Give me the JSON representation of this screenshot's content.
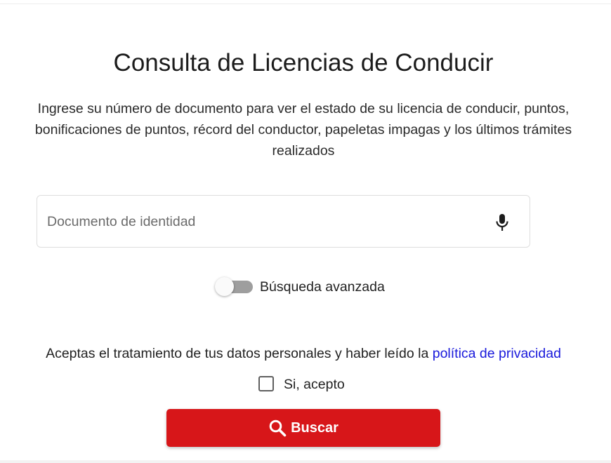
{
  "page": {
    "title": "Consulta de Licencias de Conducir",
    "description": "Ingrese su número de documento para ver el estado de su licencia de conducir, puntos, bonificaciones de puntos, récord del conductor, papeletas impagas y los últimos trámites realizados"
  },
  "search": {
    "placeholder": "Documento de identidad",
    "value": "",
    "voice_icon": "microphone-icon"
  },
  "advanced_search": {
    "label": "Búsqueda avanzada",
    "enabled": false
  },
  "consent": {
    "text": "Aceptas el tratamiento de tus datos personales y haber leído la ",
    "link_label": "política de privacidad",
    "checkbox_label": "Si, acepto",
    "checked": false
  },
  "submit": {
    "label": "Buscar",
    "icon": "search-icon"
  },
  "colors": {
    "primary": "#d71619",
    "link": "#1a1adb",
    "toggle_off": "#9e9e9e"
  }
}
